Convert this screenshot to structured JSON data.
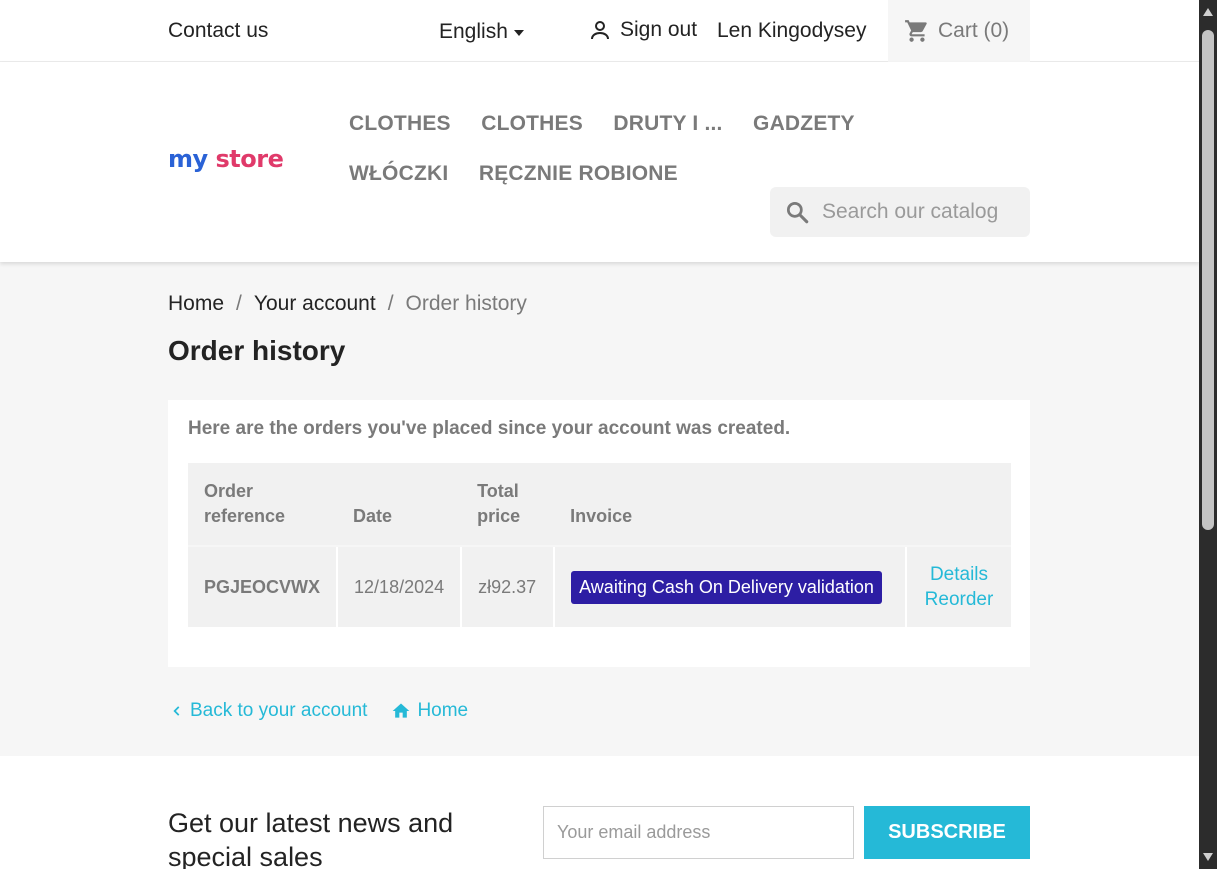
{
  "topbar": {
    "contact": "Contact us",
    "language": "English",
    "signout": "Sign out",
    "user_name": "Len Kingodysey",
    "cart": "Cart (0)"
  },
  "logo": {
    "part1": "my ",
    "part2": "store"
  },
  "nav": {
    "items": [
      "CLOTHES",
      "CLOTHES",
      "DRUTY I ...",
      "GADZETY",
      "WŁÓCZKI",
      "RĘCZNIE ROBIONE"
    ]
  },
  "search": {
    "placeholder": "Search our catalog"
  },
  "breadcrumb": {
    "home": "Home",
    "account": "Your account",
    "current": "Order history",
    "separator": "/"
  },
  "page": {
    "title": "Order history",
    "intro": "Here are the orders you've placed since your account was created."
  },
  "table": {
    "headers": [
      "Order reference",
      "Date",
      "Total price",
      "Invoice"
    ],
    "row": {
      "reference": "PGJEOCVWX",
      "date": "12/18/2024",
      "total": "zł92.37",
      "status": "Awaiting Cash On Delivery validation",
      "details": "Details",
      "reorder": "Reorder"
    }
  },
  "links": {
    "back": "Back to your account",
    "home": "Home"
  },
  "newsletter": {
    "title": "Get our latest news and special sales",
    "placeholder": "Your email address",
    "button": "SUBSCRIBE"
  },
  "colors": {
    "accent": "#25b9d7",
    "status_badge": "#2d1ea4"
  }
}
